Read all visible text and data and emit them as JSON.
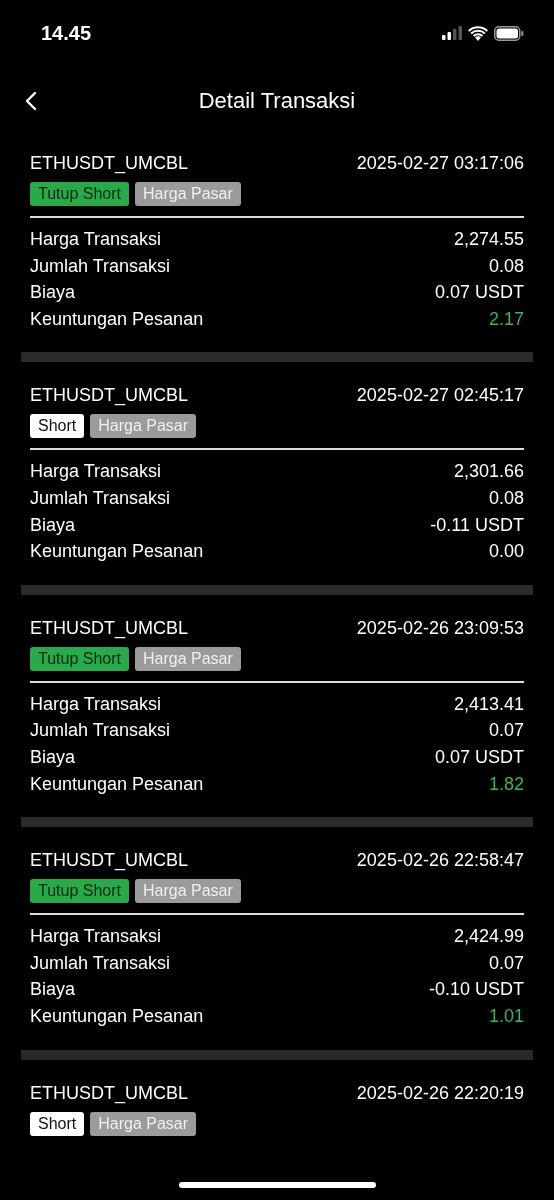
{
  "status_bar": {
    "time": "14.45"
  },
  "header": {
    "title": "Detail Transaksi"
  },
  "transactions": [
    {
      "symbol": "ETHUSDT_UMCBL",
      "time": "2025-02-27 03:17:06",
      "tags": [
        {
          "label": "Tutup Short",
          "kind": "close"
        },
        {
          "label": "Harga Pasar",
          "kind": "order_type"
        }
      ],
      "details": [
        {
          "label": "Harga Transaksi",
          "value": "2,274.55",
          "highlight": false
        },
        {
          "label": "Jumlah Transaksi",
          "value": "0.08",
          "highlight": false
        },
        {
          "label": "Biaya",
          "value": "0.07 USDT",
          "highlight": false
        },
        {
          "label": "Keuntungan Pesanan",
          "value": "2.17",
          "highlight": true
        }
      ]
    },
    {
      "symbol": "ETHUSDT_UMCBL",
      "time": "2025-02-27 02:45:17",
      "tags": [
        {
          "label": "Short",
          "kind": "open"
        },
        {
          "label": "Harga Pasar",
          "kind": "order_type"
        }
      ],
      "details": [
        {
          "label": "Harga Transaksi",
          "value": "2,301.66",
          "highlight": false
        },
        {
          "label": "Jumlah Transaksi",
          "value": "0.08",
          "highlight": false
        },
        {
          "label": "Biaya",
          "value": "-0.11 USDT",
          "highlight": false
        },
        {
          "label": "Keuntungan Pesanan",
          "value": "0.00",
          "highlight": false
        }
      ]
    },
    {
      "symbol": "ETHUSDT_UMCBL",
      "time": "2025-02-26 23:09:53",
      "tags": [
        {
          "label": "Tutup Short",
          "kind": "close"
        },
        {
          "label": "Harga Pasar",
          "kind": "order_type"
        }
      ],
      "details": [
        {
          "label": "Harga Transaksi",
          "value": "2,413.41",
          "highlight": false
        },
        {
          "label": "Jumlah Transaksi",
          "value": "0.07",
          "highlight": false
        },
        {
          "label": "Biaya",
          "value": "0.07 USDT",
          "highlight": false
        },
        {
          "label": "Keuntungan Pesanan",
          "value": "1.82",
          "highlight": true
        }
      ]
    },
    {
      "symbol": "ETHUSDT_UMCBL",
      "time": "2025-02-26 22:58:47",
      "tags": [
        {
          "label": "Tutup Short",
          "kind": "close"
        },
        {
          "label": "Harga Pasar",
          "kind": "order_type"
        }
      ],
      "details": [
        {
          "label": "Harga Transaksi",
          "value": "2,424.99",
          "highlight": false
        },
        {
          "label": "Jumlah Transaksi",
          "value": "0.07",
          "highlight": false
        },
        {
          "label": "Biaya",
          "value": "-0.10 USDT",
          "highlight": false
        },
        {
          "label": "Keuntungan Pesanan",
          "value": "1.01",
          "highlight": true
        }
      ]
    },
    {
      "symbol": "ETHUSDT_UMCBL",
      "time": "2025-02-26 22:20:19",
      "tags": [
        {
          "label": "Short",
          "kind": "open"
        },
        {
          "label": "Harga Pasar",
          "kind": "order_type"
        }
      ]
    }
  ]
}
